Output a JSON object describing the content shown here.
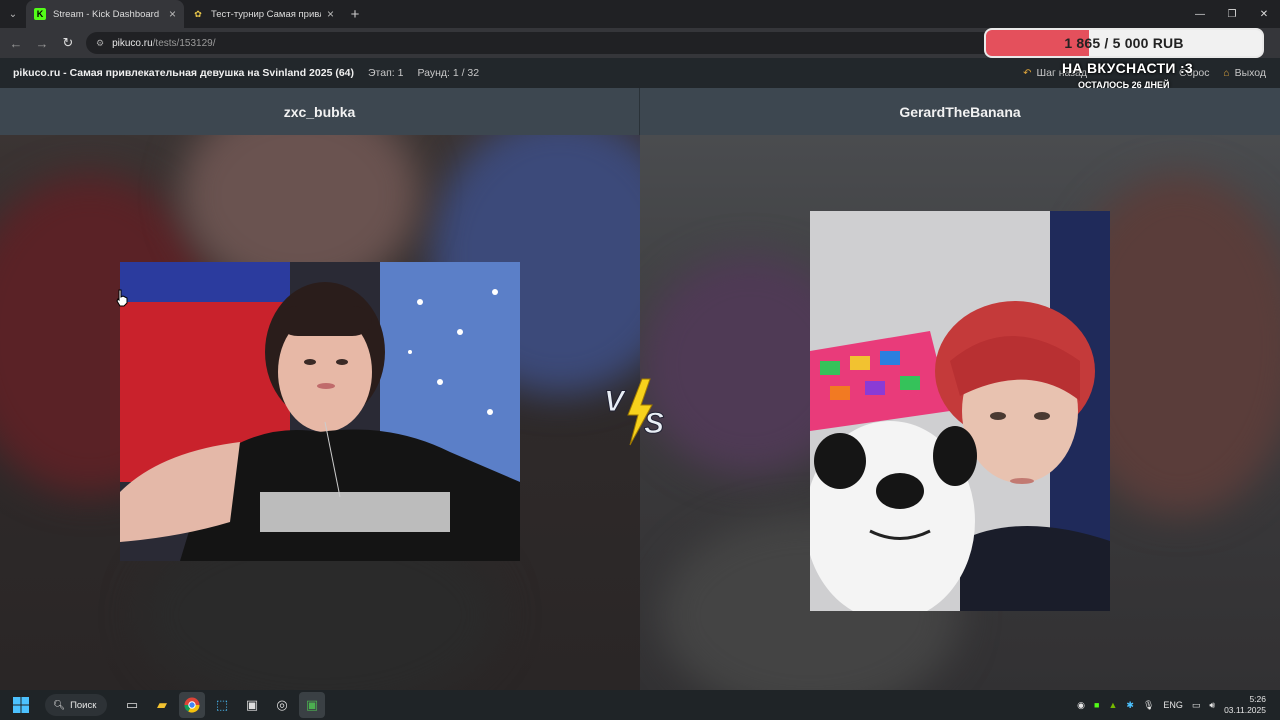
{
  "browser": {
    "tabs": [
      {
        "title": "Stream - Kick Dashboard",
        "active": true
      },
      {
        "title": "Тест-турнир Самая привлекат",
        "active": false
      }
    ],
    "address": {
      "host": "pikuco.ru",
      "path": "/tests/153129/"
    }
  },
  "donation_goal": {
    "amount_label": "1 865 / 5 000 RUB",
    "progress_fraction": 0.373,
    "title": "НА ВКУСНАСТИ :3",
    "subtitle": "ОСТАЛОСЬ 26 ДНЕЙ",
    "fill_color": "#e4505c"
  },
  "page": {
    "title": "pikuco.ru - Самая привлекательная девушка на Svinland 2025 (64)",
    "stage": "Этап: 1",
    "round": "Раунд: 1 / 32",
    "step_back": "Шаг назад",
    "reset": "Сброс",
    "exit": "Выход"
  },
  "contestants": {
    "left": {
      "name": "zxc_bubka"
    },
    "right": {
      "name": "GerardTheBanana"
    }
  },
  "vs_label": "VS",
  "taskbar": {
    "search_label": "Поиск",
    "lang": "ENG",
    "time": "5:26",
    "date": "03.11.2025"
  }
}
